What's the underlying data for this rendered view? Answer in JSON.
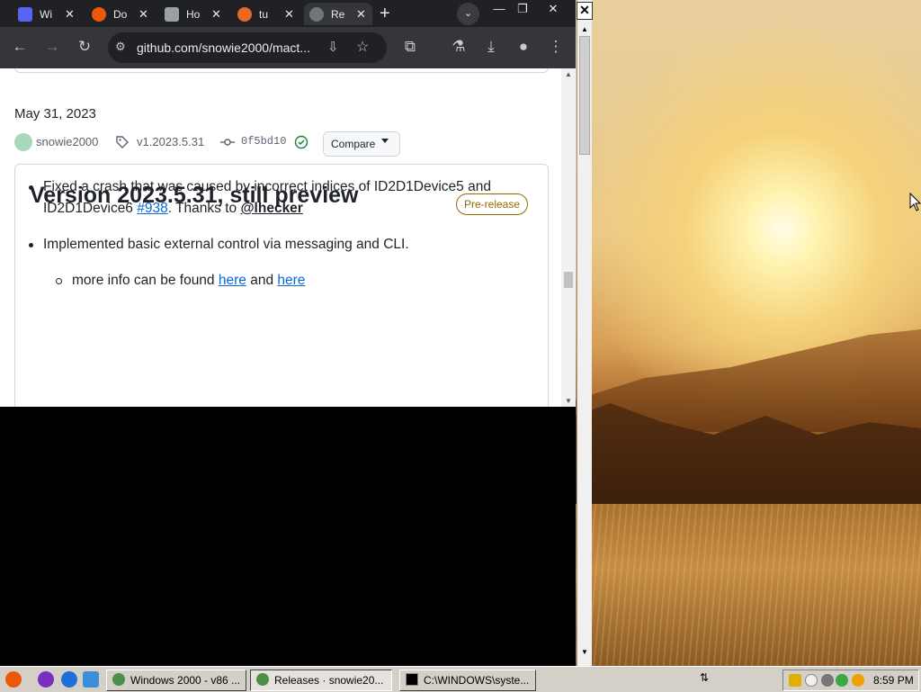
{
  "browser": {
    "tabs": [
      {
        "title": "Wi"
      },
      {
        "title": "Do"
      },
      {
        "title": "Ho"
      },
      {
        "title": "tu"
      },
      {
        "title": "Re"
      }
    ],
    "url": "github.com/snowie2000/mact..."
  },
  "release": {
    "date": "May 31, 2023",
    "author": "snowie2000",
    "tag": "v1.2023.5.31",
    "commit": "0f5bd10",
    "compare_label": "Compare",
    "title": "Version 2023.5.31, still preview",
    "badge": "Pre-release",
    "notes": {
      "item1_text": "Fixed a crash that was caused by incorrect indices of ID2D1Device5 and ID2D1Device6 ",
      "item1_link": "#938",
      "item1_mid": ". Thanks to ",
      "item1_mention": "@lhecker",
      "item2_text": "Implemented basic external control via messaging and CLI.",
      "item3_text": "more info can be found ",
      "item3_link1": "here",
      "item3_and": " and ",
      "item3_link2": "here"
    }
  },
  "taskbar": {
    "buttons": [
      {
        "label": "Windows 2000 - v86 ..."
      },
      {
        "label": "Releases · snowie20..."
      },
      {
        "label": "C:\\WINDOWS\\syste..."
      }
    ],
    "clock": "8:59 PM"
  },
  "colors": {
    "accent_link": "#0969da",
    "prerelease": "#9a6700",
    "browser_dark": "#202124"
  }
}
